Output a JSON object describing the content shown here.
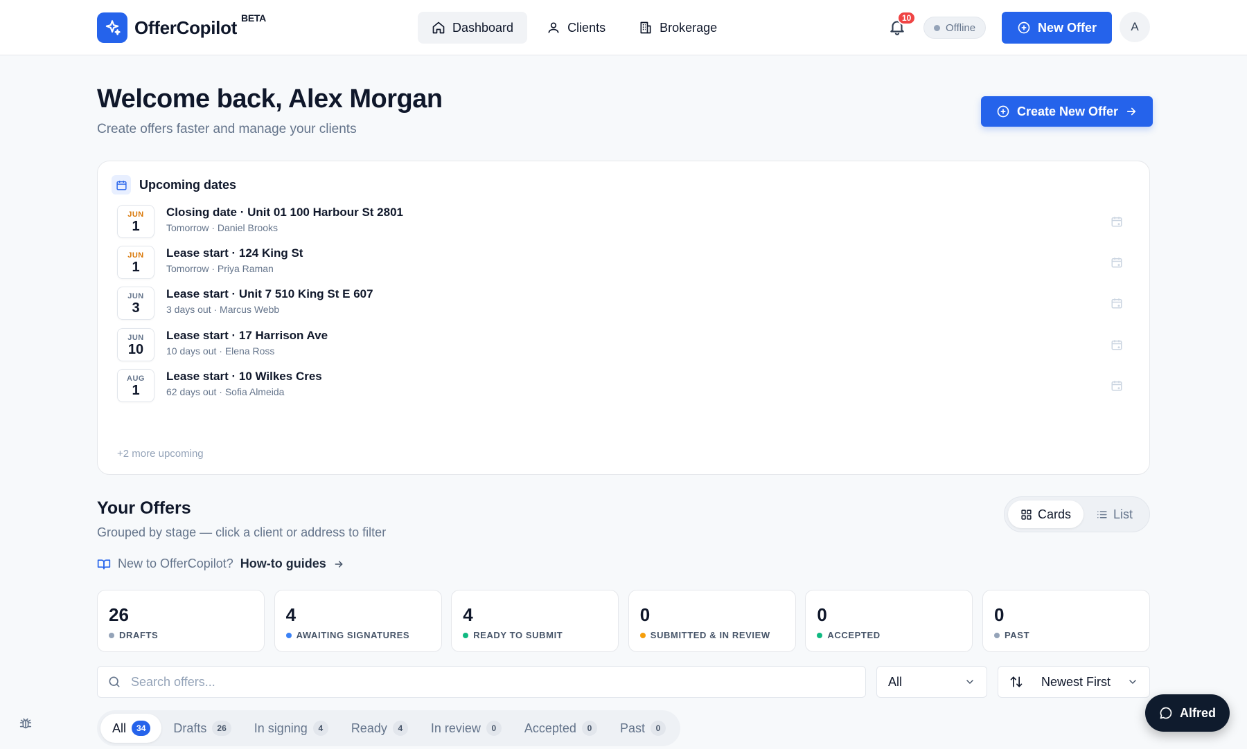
{
  "brand": {
    "name": "OfferCopilot",
    "tag": "BETA"
  },
  "nav": [
    {
      "label": "Dashboard",
      "icon": "home-icon",
      "active": true
    },
    {
      "label": "Clients",
      "icon": "user-icon",
      "active": false
    },
    {
      "label": "Brokerage",
      "icon": "building-icon",
      "active": false
    }
  ],
  "header": {
    "notifications": "10",
    "status": "Offline",
    "new_offer": "New Offer",
    "avatar": "A"
  },
  "welcome": {
    "title": "Welcome back, Alex Morgan",
    "subtitle": "Create offers faster and manage your clients",
    "create_button": "Create New Offer"
  },
  "upcoming": {
    "title": "Upcoming dates",
    "events": [
      {
        "month": "JUN",
        "day": "1",
        "highlight": true,
        "title": "Closing date · Unit 01 100 Harbour St 2801",
        "sub": "Tomorrow · Daniel Brooks"
      },
      {
        "month": "JUN",
        "day": "1",
        "highlight": true,
        "title": "Lease start · 124 King St",
        "sub": "Tomorrow · Priya Raman"
      },
      {
        "month": "JUN",
        "day": "3",
        "highlight": false,
        "title": "Lease start · Unit 7 510 King St E 607",
        "sub": "3 days out · Marcus Webb"
      },
      {
        "month": "JUN",
        "day": "10",
        "highlight": false,
        "title": "Lease start · 17 Harrison Ave",
        "sub": "10 days out · Elena Ross"
      },
      {
        "month": "AUG",
        "day": "1",
        "highlight": false,
        "title": "Lease start · 10 Wilkes Cres",
        "sub": "62 days out · Sofia Almeida"
      }
    ],
    "more": "+2 more upcoming"
  },
  "offers": {
    "title": "Your Offers",
    "subtitle": "Grouped by stage — click a client or address to filter",
    "guide_question": "New to OfferCopilot?",
    "guide_link": "How-to guides",
    "view_cards": "Cards",
    "view_list": "List",
    "stats": [
      {
        "num": "26",
        "label": "DRAFTS",
        "color": "#94a3b8"
      },
      {
        "num": "4",
        "label": "AWAITING SIGNATURES",
        "color": "#3b82f6"
      },
      {
        "num": "4",
        "label": "READY TO SUBMIT",
        "color": "#10b981"
      },
      {
        "num": "0",
        "label": "SUBMITTED & IN REVIEW",
        "color": "#f59e0b"
      },
      {
        "num": "0",
        "label": "ACCEPTED",
        "color": "#10b981"
      },
      {
        "num": "0",
        "label": "PAST",
        "color": "#94a3b8"
      }
    ],
    "search_placeholder": "Search offers...",
    "filter_value": "All",
    "sort_value": "Newest First",
    "tabs": [
      {
        "label": "All",
        "count": "34",
        "active": true
      },
      {
        "label": "Drafts",
        "count": "26",
        "active": false
      },
      {
        "label": "In signing",
        "count": "4",
        "active": false
      },
      {
        "label": "Ready",
        "count": "4",
        "active": false
      },
      {
        "label": "In review",
        "count": "0",
        "active": false
      },
      {
        "label": "Accepted",
        "count": "0",
        "active": false
      },
      {
        "label": "Past",
        "count": "0",
        "active": false
      }
    ]
  },
  "assistant": {
    "label": "Alfred"
  },
  "colors": {
    "primary": "#2563eb",
    "highlight_month": "#d97706",
    "muted_month": "#64748b"
  }
}
